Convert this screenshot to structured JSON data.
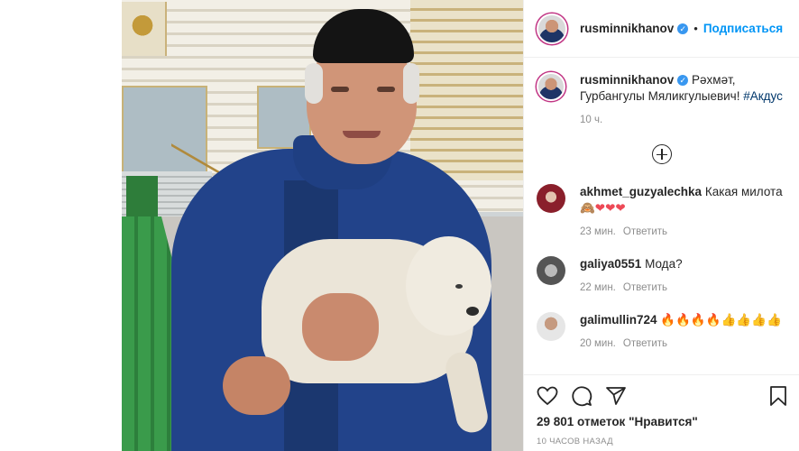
{
  "post": {
    "author": "rusminnikhanov",
    "follow_label": "Подписаться",
    "dot": "•",
    "likes": "29 801 отметок \"Нравится\"",
    "timestamp": "10 ЧАСОВ НАЗАД"
  },
  "caption": {
    "user": "rusminnikhanov",
    "text": "Рәхмәт, Гурбангулы Мяликгулыевич!",
    "hashtag": "#Акдус",
    "time": "10 ч."
  },
  "comments": [
    {
      "user": "akhmet_guzyalechka",
      "text": "Какая милота",
      "emoji": "🙈❤❤❤",
      "time": "23 мин.",
      "reply": "Ответить"
    },
    {
      "user": "galiya0551",
      "text": "Мода?",
      "time": "22 мин.",
      "reply": "Ответить"
    },
    {
      "user": "galimullin724",
      "emoji": "🔥🔥🔥🔥👍👍👍👍",
      "time": "20 мин.",
      "reply": "Ответить"
    }
  ],
  "icons": [
    "heart-icon",
    "comment-icon",
    "share-icon",
    "bookmark-icon",
    "load-more-icon",
    "verified-badge-icon"
  ],
  "colors": {
    "accent": "#0095f6",
    "verified": "#3897f0",
    "muted": "#8e8e8e",
    "hashtag": "#00376b"
  }
}
